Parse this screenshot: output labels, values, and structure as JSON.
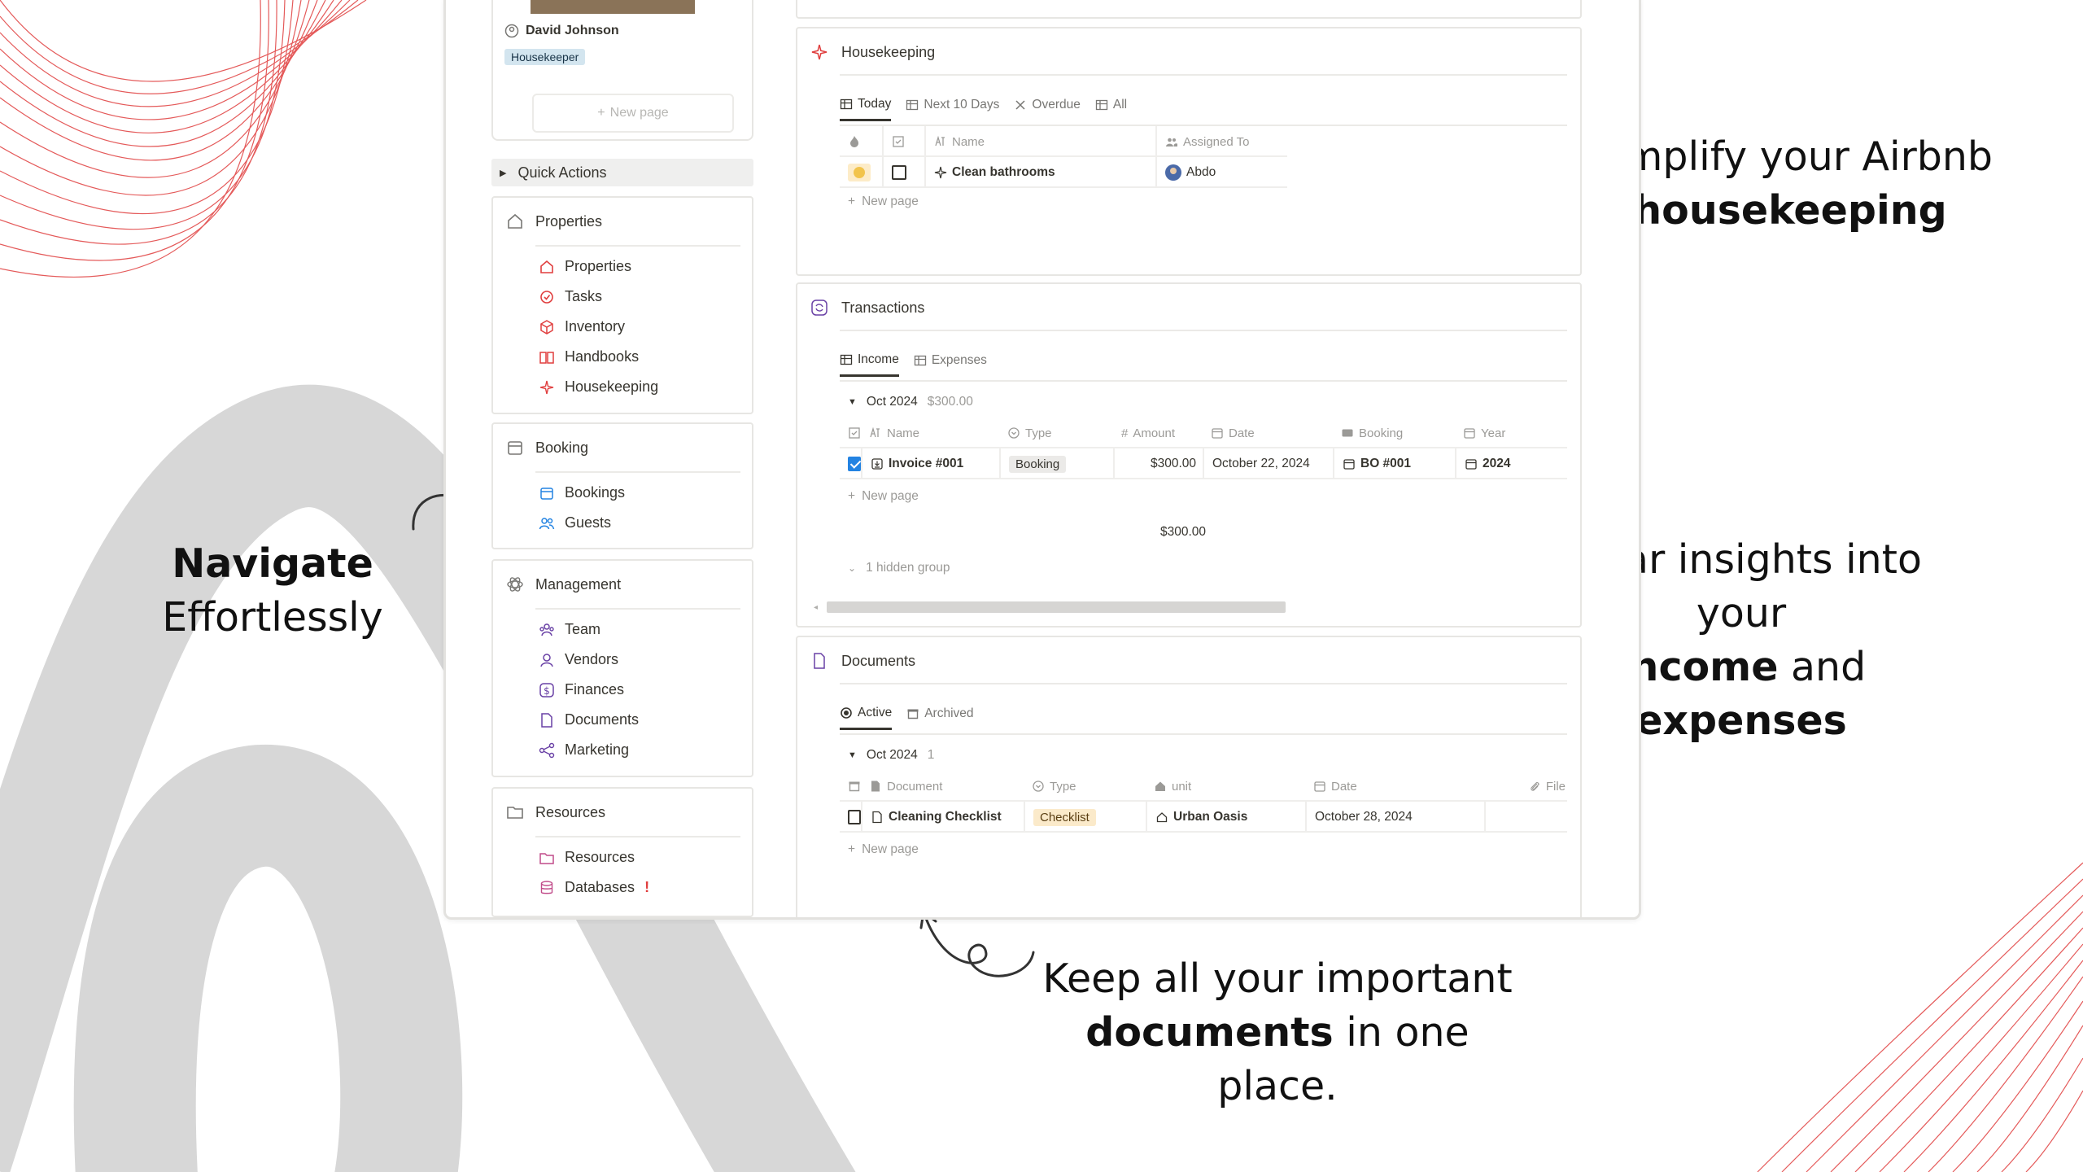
{
  "annotations": {
    "housekeeping_line1": "Simplify your Airbnb",
    "housekeeping_line2": "housekeeping",
    "navigate_line1": "Navigate",
    "navigate_line2": "Effortlessly",
    "insights_line1": "Clear insights into your",
    "insights_bold1": "income",
    "insights_mid": " and ",
    "insights_bold2": "expenses",
    "documents_line1": "Keep all your important",
    "documents_bold": "documents",
    "documents_rest": " in one place."
  },
  "sidebar": {
    "person_name": "David Johnson",
    "person_role": "Housekeeper",
    "new_page": "New page",
    "quick_actions": "Quick Actions",
    "sections": [
      {
        "title": "Properties",
        "items": [
          "Properties",
          "Tasks",
          "Inventory",
          "Handbooks",
          "Housekeeping"
        ]
      },
      {
        "title": "Booking",
        "items": [
          "Bookings",
          "Guests"
        ]
      },
      {
        "title": "Management",
        "items": [
          "Team",
          "Vendors",
          "Finances",
          "Documents",
          "Marketing"
        ]
      },
      {
        "title": "Resources",
        "items": [
          "Resources",
          "Databases"
        ]
      }
    ],
    "databases_mark": "!"
  },
  "housekeeping": {
    "title": "Housekeeping",
    "tabs": [
      "Today",
      "Next 10 Days",
      "Overdue",
      "All"
    ],
    "columns": {
      "name": "Name",
      "assigned": "Assigned To"
    },
    "rows": [
      {
        "name": "Clean bathrooms",
        "assigned": "Abdo"
      }
    ],
    "new_page": "New page"
  },
  "transactions": {
    "title": "Transactions",
    "tabs": [
      "Income",
      "Expenses"
    ],
    "group": {
      "label": "Oct 2024",
      "sum": "$300.00"
    },
    "columns": {
      "name": "Name",
      "type": "Type",
      "amount": "Amount",
      "date": "Date",
      "booking": "Booking",
      "year": "Year"
    },
    "rows": [
      {
        "checked": true,
        "name": "Invoice #001",
        "type": "Booking",
        "amount": "$300.00",
        "date": "October 22, 2024",
        "booking": "BO #001",
        "year": "2024"
      }
    ],
    "new_page": "New page",
    "total": "$300.00",
    "hidden_group": "1 hidden group"
  },
  "documents": {
    "title": "Documents",
    "tabs": [
      "Active",
      "Archived"
    ],
    "group": {
      "label": "Oct 2024",
      "count": "1"
    },
    "columns": {
      "document": "Document",
      "type": "Type",
      "unit": "unit",
      "date": "Date",
      "file": "File"
    },
    "rows": [
      {
        "document": "Cleaning Checklist",
        "type": "Checklist",
        "unit": "Urban Oasis",
        "date": "October 28, 2024"
      }
    ],
    "new_page": "New page"
  },
  "colors": {
    "accent_red": "#e03e3e",
    "arc_grey": "#d7d7d7",
    "check_blue": "#2383e2"
  }
}
